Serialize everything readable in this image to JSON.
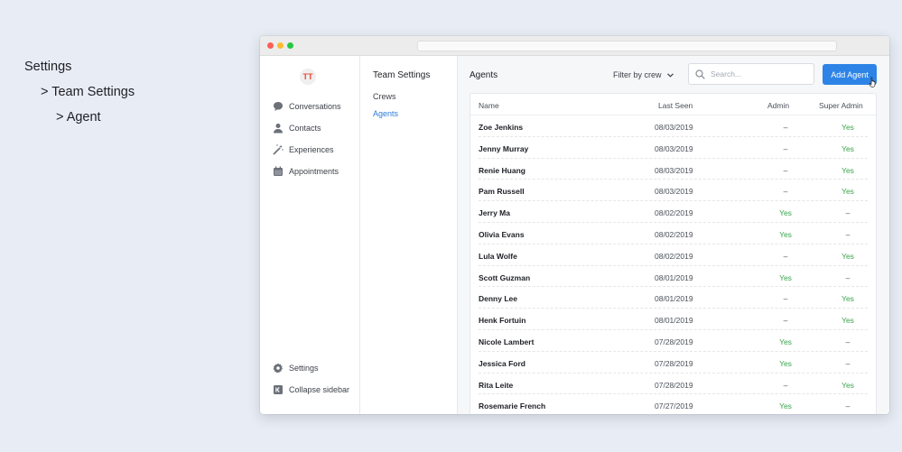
{
  "breadcrumb": [
    "Settings",
    "> Team Settings",
    "> Agent"
  ],
  "sidebar": {
    "logo_text": "TT",
    "items": [
      {
        "label": "Conversations",
        "icon": "chat-bubble-icon"
      },
      {
        "label": "Contacts",
        "icon": "person-icon"
      },
      {
        "label": "Experiences",
        "icon": "magic-wand-icon"
      },
      {
        "label": "Appointments",
        "icon": "calendar-icon"
      }
    ],
    "bottom_items": [
      {
        "label": "Settings",
        "icon": "gear-icon"
      },
      {
        "label": "Collapse sidebar",
        "icon": "collapse-icon"
      }
    ]
  },
  "subnav": {
    "title": "Team Settings",
    "items": [
      {
        "label": "Crews",
        "active": false
      },
      {
        "label": "Agents",
        "active": true
      }
    ]
  },
  "main": {
    "title": "Agents",
    "filter_label": "Filter by crew",
    "search_placeholder": "Search...",
    "add_button": "Add Agent"
  },
  "table": {
    "columns": [
      "Name",
      "Last Seen",
      "Admin",
      "Super Admin"
    ],
    "rows": [
      {
        "name": "Zoe Jenkins",
        "last_seen": "08/03/2019",
        "admin": "–",
        "super_admin": "Yes"
      },
      {
        "name": "Jenny Murray",
        "last_seen": "08/03/2019",
        "admin": "–",
        "super_admin": "Yes"
      },
      {
        "name": "Renie Huang",
        "last_seen": "08/03/2019",
        "admin": "–",
        "super_admin": "Yes"
      },
      {
        "name": "Pam Russell",
        "last_seen": "08/03/2019",
        "admin": "–",
        "super_admin": "Yes"
      },
      {
        "name": "Jerry Ma",
        "last_seen": "08/02/2019",
        "admin": "Yes",
        "super_admin": "–"
      },
      {
        "name": "Olivia Evans",
        "last_seen": "08/02/2019",
        "admin": "Yes",
        "super_admin": "–"
      },
      {
        "name": "Lula Wolfe",
        "last_seen": "08/02/2019",
        "admin": "–",
        "super_admin": "Yes"
      },
      {
        "name": "Scott Guzman",
        "last_seen": "08/01/2019",
        "admin": "Yes",
        "super_admin": "–"
      },
      {
        "name": "Denny Lee",
        "last_seen": "08/01/2019",
        "admin": "–",
        "super_admin": "Yes"
      },
      {
        "name": "Henk Fortuin",
        "last_seen": "08/01/2019",
        "admin": "–",
        "super_admin": "Yes"
      },
      {
        "name": "Nicole Lambert",
        "last_seen": "07/28/2019",
        "admin": "Yes",
        "super_admin": "–"
      },
      {
        "name": "Jessica Ford",
        "last_seen": "07/28/2019",
        "admin": "Yes",
        "super_admin": "–"
      },
      {
        "name": "Rita Leite",
        "last_seen": "07/28/2019",
        "admin": "–",
        "super_admin": "Yes"
      },
      {
        "name": "Rosemarie French",
        "last_seen": "07/27/2019",
        "admin": "Yes",
        "super_admin": "–"
      }
    ]
  },
  "colors": {
    "accent": "#2d84e6",
    "active_link": "#2b7bd8",
    "yes": "#3aa54d",
    "background": "#e8ecf4"
  }
}
